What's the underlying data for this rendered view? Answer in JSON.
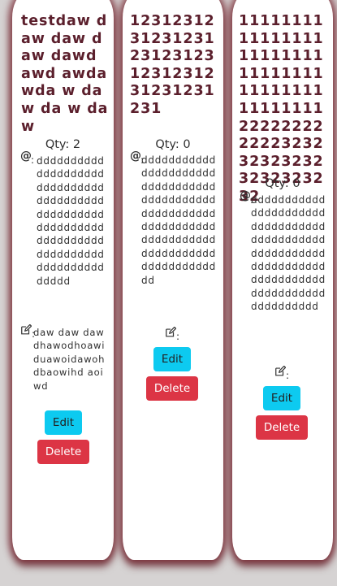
{
  "cards": [
    {
      "title": "testdaw daw daw daw dawd awd awda wda w daw da w daw",
      "qty_label": "Qty: 2",
      "at_colon": ":",
      "email_value": "ddddddddddddddddddddddddddddddddddddddddddddddddddddddddddddddddddddddddddddddddddddddddddddddd",
      "note_colon": ":",
      "note_value": "daw daw daw dhawodhoawiduawoidawohdbaowihd aoiwd",
      "edit_label": "Edit",
      "delete_label": "Delete"
    },
    {
      "title": "1231231231231231231231231231231231231231231",
      "qty_label": "Qty: 0",
      "at_colon": ":",
      "email_value": "ddddddddddddddddddddddddddddddddddddddddddddddddddddddddddddddddddddddddddddddddddddddddddddddddddddd",
      "note_colon": ":",
      "note_value": "",
      "edit_label": "Edit",
      "delete_label": "Delete"
    },
    {
      "title": "1111111111111111111111111111111111111111111111112222222222223232323232323232323232",
      "qty_label": "Qty: 0",
      "at_colon": ":",
      "email_value": "dddddddddddddddddddddddddddddddddddddddddddddddddddddddddddddddddddddddddddddddddddddddddddddddddd",
      "note_colon": ":",
      "note_value": "",
      "edit_label": "Edit",
      "delete_label": "Delete"
    }
  ]
}
